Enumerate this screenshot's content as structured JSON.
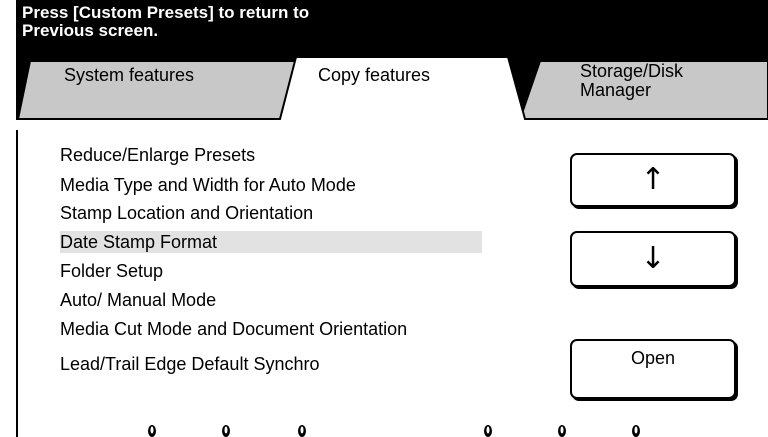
{
  "header": {
    "message_line1": "Press [Custom Presets] to return to",
    "message_line2": "Previous screen."
  },
  "tabs": [
    {
      "label": "System features",
      "active": false
    },
    {
      "label": "Copy features",
      "active": true
    },
    {
      "label_line1": "Storage/Disk",
      "label_line2": "Manager",
      "active": false
    }
  ],
  "menu": {
    "items": [
      "Reduce/Enlarge Presets",
      "Media Type and Width for Auto Mode",
      "Stamp Location and Orientation",
      "Date Stamp Format",
      "Folder Setup",
      "Auto/ Manual Mode",
      "Media Cut Mode and Document Orientation",
      "Lead/Trail Edge Default Synchro"
    ],
    "selected": "Date Stamp Format"
  },
  "buttons": {
    "scroll_up_icon": "up-arrow-icon",
    "scroll_down_icon": "down-arrow-icon",
    "open_label": "Open"
  },
  "colors": {
    "header_bg": "#000000",
    "header_text": "#ffffff",
    "inactive_tab": "#c8c8c8",
    "selected_row": "#e2e2e2"
  }
}
